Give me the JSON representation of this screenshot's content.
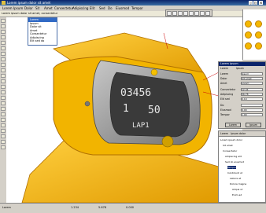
{
  "window": {
    "title": "Lorem ipsum dolor sit amet",
    "min": "_",
    "max": "□",
    "close": "×"
  },
  "menu": [
    "Lorem",
    "Ipsum",
    "Dolor",
    "Sit",
    "Amet",
    "Consectetur",
    "Adipiscing",
    "Elit",
    "Sed",
    "Do",
    "Eiusmod",
    "Tempor"
  ],
  "command": {
    "text": "Lorem ipsum dolor sit amet, consectetur"
  },
  "dropdown": {
    "items": [
      "Lorem",
      "Ipsum",
      "Dolor sit",
      "Amet",
      "Consectetur",
      "Adipiscing",
      "Elit sed do"
    ],
    "selected_index": 0
  },
  "watch": {
    "display_line1": "03456",
    "display_line2a": "1",
    "display_line2b": "50",
    "display_line3": "LAP1"
  },
  "props": {
    "title": "Lorem ipsum",
    "tabs": [
      "Lorem",
      "Ipsum"
    ],
    "rows": [
      {
        "label": "Lorem",
        "value": "Ipsum"
      },
      {
        "label": "Dolor",
        "value": "Sit amet"
      },
      {
        "label": "Amet",
        "value": "Lorem"
      },
      {
        "label": "Consectetur",
        "value": "12.34"
      },
      {
        "label": "Adipiscing",
        "value": "56.78"
      },
      {
        "label": "Elit sed",
        "value": "0.10"
      },
      {
        "label": "Do",
        "value": ""
      },
      {
        "label": "Eiusmod",
        "value": "9.00"
      },
      {
        "label": "Tempor",
        "value": "1.00"
      }
    ],
    "apply": "Lorem",
    "close": "Ipsum"
  },
  "tree": {
    "tabs": [
      "Lorem",
      "Ipsum dolor"
    ],
    "nodes": [
      "Lorem ipsum dolor",
      "Sit amet",
      "Consectetur",
      "Adipiscing elit",
      "Sed do eiusmod",
      "Tempor",
      "Incididunt ut",
      "Labore et",
      "Dolore magna",
      "Aliqua ut",
      "Enim ad"
    ]
  },
  "status": {
    "left": "Lorem",
    "x": "1.234",
    "y": "5.678",
    "z": "0.000"
  }
}
